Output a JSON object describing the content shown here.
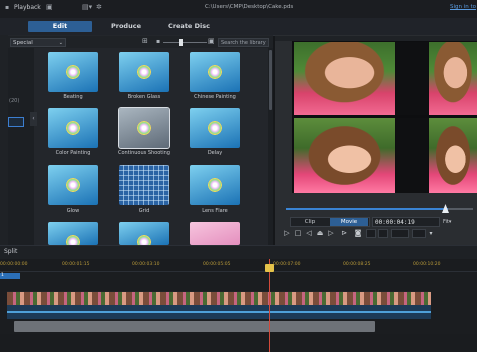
{
  "titlebar": {
    "menu_playback": "Playback",
    "path": "C:\\Users\\CMP\\Desktop\\Cake.pds",
    "sign_in": "Sign in to"
  },
  "tabs": [
    {
      "label": "Edit"
    },
    {
      "label": "Produce"
    },
    {
      "label": "Create Disc"
    }
  ],
  "library": {
    "filter": "Special",
    "search_placeholder": "Search the library",
    "rail_count": "(20)",
    "effects": [
      {
        "label": "Beating"
      },
      {
        "label": "Broken Glass"
      },
      {
        "label": "Chinese Painting"
      },
      {
        "label": "Color Painting"
      },
      {
        "label": "Continuous Shooting"
      },
      {
        "label": "Delay"
      },
      {
        "label": "Glow"
      },
      {
        "label": "Grid"
      },
      {
        "label": "Lens Flare"
      }
    ]
  },
  "preview": {
    "mode_clip": "Clip",
    "mode_movie": "Movie",
    "timecode": "00:00:04:19",
    "fit": "Fit",
    "scrub_position_pct": 92
  },
  "timeline": {
    "split_label": "Split",
    "ruler_ticks": [
      "00:00:00:00",
      "00:00:01:15",
      "00:00:03:10",
      "00:00:05:05",
      "00:00:07:00",
      "00:00:08:25",
      "00:00:10:20"
    ],
    "track_label": "1"
  },
  "colors": {
    "accent": "#2d5f95",
    "playhead": "#d34a3a",
    "ruler_text": "#b99a3a"
  }
}
